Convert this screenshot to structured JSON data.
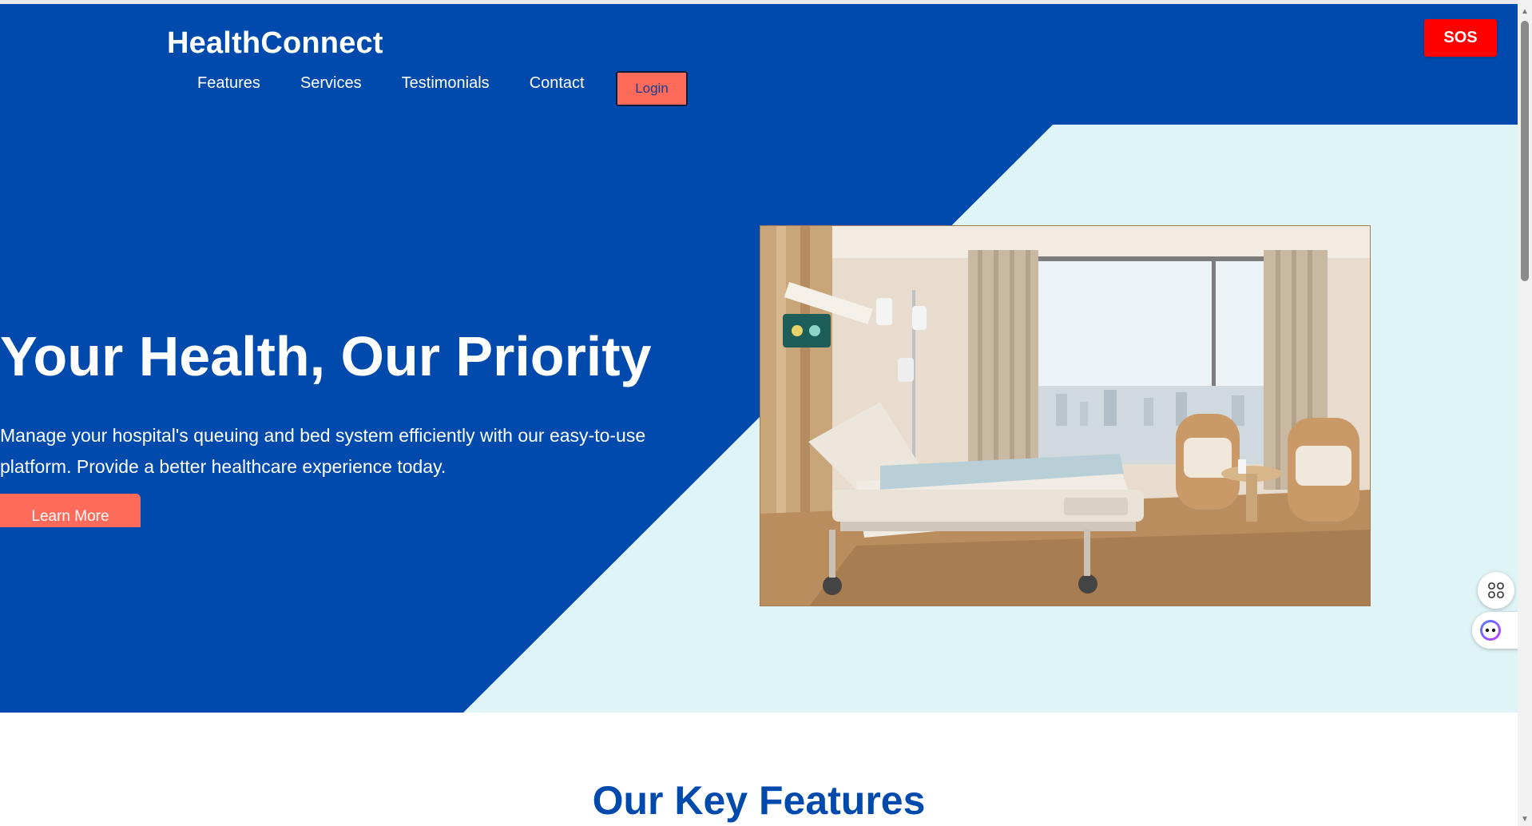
{
  "header": {
    "brand": "HealthConnect",
    "nav": [
      "Features",
      "Services",
      "Testimonials",
      "Contact"
    ],
    "login_label": "Login",
    "sos_label": "SOS"
  },
  "hero": {
    "title": "Your Health, Our Priority",
    "description": "Manage your hospital's queuing and bed system efficiently with our easy-to-use platform. Provide a better healthcare experience today.",
    "cta_label": "Learn More"
  },
  "features": {
    "title": "Our Key Features"
  },
  "colors": {
    "primary": "#004aad",
    "accent": "#ff6b5b",
    "sos": "#ff0000",
    "light_panel": "#dff4f7"
  },
  "icons": {
    "float_1": "apps-grid-icon",
    "float_2": "assistant-face-icon"
  }
}
